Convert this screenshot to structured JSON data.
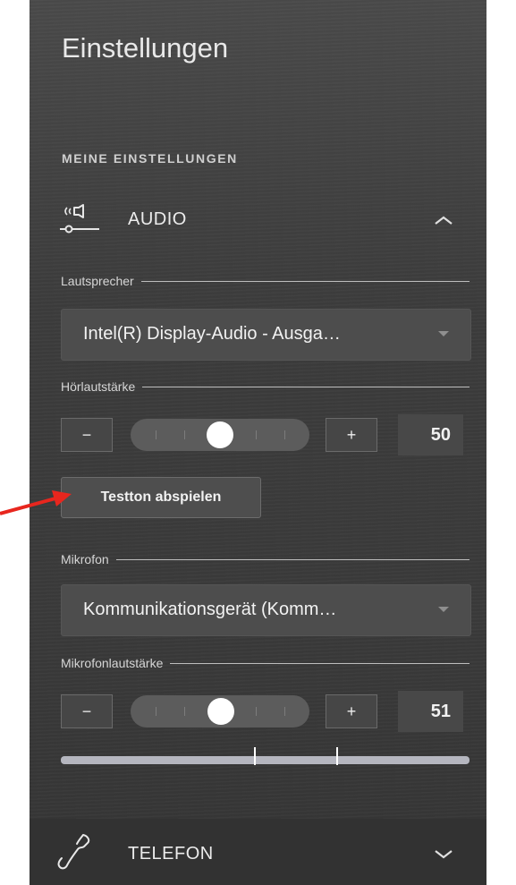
{
  "title": "Einstellungen",
  "section_label": "MEINE EINSTELLUNGEN",
  "audio": {
    "label": "AUDIO",
    "icon": "audio-device-icon",
    "expanded": true,
    "speaker": {
      "label": "Lautsprecher",
      "selected": "Intel(R) Display-Audio - Ausga…"
    },
    "listen_volume": {
      "label": "Hörlautstärke",
      "minus": "−",
      "plus": "+",
      "value": "50",
      "level": 50
    },
    "test_button": "Testton abspielen",
    "microphone": {
      "label": "Mikrofon",
      "selected": "Kommunikationsgerät (Komm…"
    },
    "mic_volume": {
      "label": "Mikrofonlautstärke",
      "minus": "−",
      "plus": "+",
      "value": "51",
      "level": 51
    }
  },
  "telefon": {
    "label": "TELEFON",
    "icon": "phone-icon",
    "expanded": false
  },
  "colors": {
    "panel_background": "#3c3c3c",
    "annotation_arrow": "#e8261e",
    "text": "#e9e9e9"
  }
}
